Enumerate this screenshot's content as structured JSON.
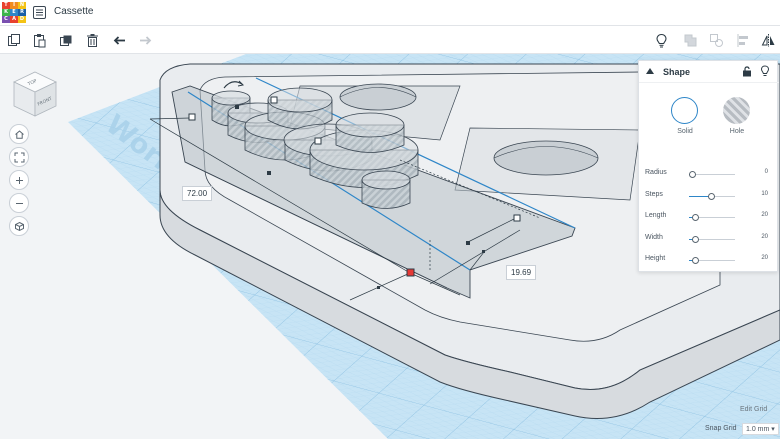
{
  "app": {
    "logo_letters": [
      "T",
      "I",
      "N",
      "K",
      "E",
      "R",
      "C",
      "A",
      "D"
    ],
    "logo_colors": [
      "#e8412e",
      "#f08b1e",
      "#f4c316",
      "#3cb44b",
      "#2e86c8",
      "#1b5fa8",
      "#7a4fb0",
      "#e8412e",
      "#f4c316"
    ],
    "document_title": "Cassette"
  },
  "toolbar": {
    "left_tools": [
      "copy-icon",
      "paste-icon",
      "duplicate-icon",
      "trash-icon",
      "undo-icon",
      "redo-icon"
    ],
    "right_tools": [
      "lightbulb-icon",
      "group-icon",
      "ungroup-icon",
      "align-icon",
      "mirror-icon"
    ]
  },
  "viewport": {
    "workplane_label": "Workplane",
    "viewcube_faces": [
      "TOP",
      "FRONT"
    ],
    "nav_controls": [
      "home-icon",
      "fit-icon",
      "zoom-in-icon",
      "zoom-out-icon",
      "perspective-icon"
    ]
  },
  "dimensions": {
    "length": "72.00",
    "width": "19.69"
  },
  "shape_panel": {
    "title": "Shape",
    "solid_label": "Solid",
    "hole_label": "Hole",
    "properties": [
      {
        "label": "Radius",
        "value": "0",
        "fraction": 0.0
      },
      {
        "label": "Steps",
        "value": "10",
        "fraction": 0.48
      },
      {
        "label": "Length",
        "value": "20",
        "fraction": 0.08
      },
      {
        "label": "Width",
        "value": "20",
        "fraction": 0.08
      },
      {
        "label": "Height",
        "value": "20",
        "fraction": 0.08
      }
    ]
  },
  "grid": {
    "edit_grid_label": "Edit Grid",
    "snap_grid_label": "Snap Grid",
    "snap_grid_value": "1.0 mm"
  },
  "colors": {
    "accent": "#2e86c8",
    "workplane": "#bfe0f3",
    "grid_line": "#8fc3e3",
    "part_fill": "#e7eaed",
    "part_edge": "#3a4652"
  }
}
